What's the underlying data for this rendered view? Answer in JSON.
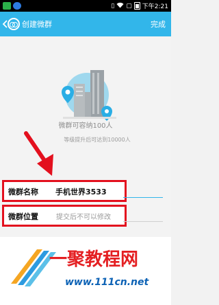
{
  "status_bar": {
    "time": "下午2:21",
    "icons": [
      "vibrate-icon",
      "wifi-icon",
      "no-sim-icon",
      "battery-icon"
    ],
    "colors": {
      "background": "#000000"
    }
  },
  "header": {
    "title": "创建微群",
    "done_label": "完成",
    "colors": {
      "background": "#32b6ea"
    }
  },
  "main": {
    "capacity_text": "微群可容纳100人",
    "upgrade_text": "等级提升后可达到10000人",
    "fields": [
      {
        "label": "微群名称",
        "value": "手机世界3533"
      },
      {
        "label": "微群位置",
        "placeholder": "提交后不可以修改"
      }
    ],
    "highlight_color": "#e3101e"
  },
  "watermark": {
    "title": "一聚教程网",
    "url": "www.111cn.net"
  }
}
